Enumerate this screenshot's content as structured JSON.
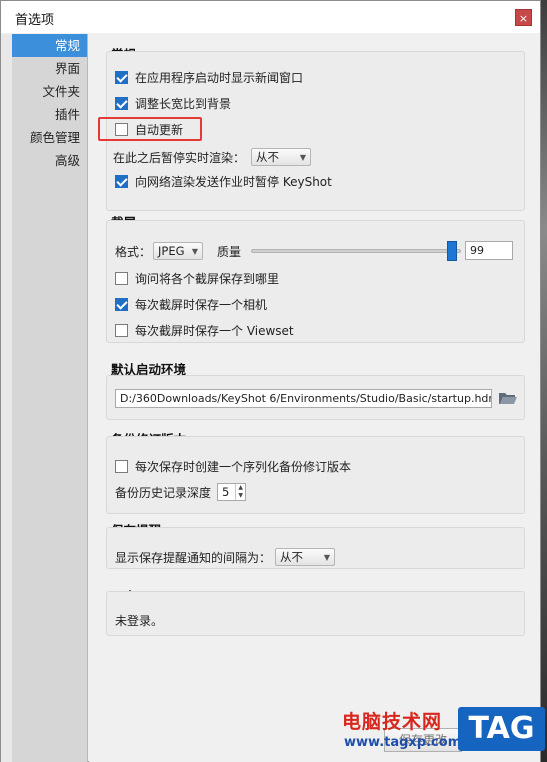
{
  "window": {
    "title": "首选项",
    "close_label": "×"
  },
  "sidebar": {
    "items": [
      {
        "label": "常规",
        "active": true
      },
      {
        "label": "界面"
      },
      {
        "label": "文件夹"
      },
      {
        "label": "插件"
      },
      {
        "label": "颜色管理"
      },
      {
        "label": "高级"
      }
    ]
  },
  "general": {
    "title": "常规",
    "show_news": {
      "label": "在应用程序启动时显示新闻窗口",
      "checked": true
    },
    "adjust_aspect": {
      "label": "调整长宽比到背景",
      "checked": true
    },
    "auto_update": {
      "label": "自动更新",
      "checked": false
    },
    "pause_render_label": "在此之后暂停实时渲染：",
    "pause_render_value": "从不",
    "pause_on_network": {
      "label": "向网络渲染发送作业时暂停 KeyShot",
      "checked": true
    }
  },
  "screenshot": {
    "title": "截屏",
    "format_label": "格式：",
    "format_value": "JPEG",
    "quality_label": "质量",
    "quality_value": "99",
    "ask_location": {
      "label": "询问将各个截屏保存到哪里",
      "checked": false
    },
    "save_camera": {
      "label": "每次截屏时保存一个相机",
      "checked": true
    },
    "save_viewset": {
      "label": "每次截屏时保存一个 Viewset",
      "checked": false
    }
  },
  "environment": {
    "title": "默认启动环境",
    "path": "D:/360Downloads/KeyShot 6/Environments/Studio/Basic/startup.hdr"
  },
  "backup": {
    "title": "备份修订版本",
    "serialize": {
      "label": "每次保存时创建一个序列化备份修订版本",
      "checked": false
    },
    "depth_label": "备份历史记录深度",
    "depth_value": "5"
  },
  "save_reminder": {
    "title": "保存提醒",
    "interval_label": "显示保存提醒通知的间隔为：",
    "interval_value": "从不"
  },
  "cloud": {
    "title": "云库",
    "status": "未登录。"
  },
  "footer": {
    "save_label": "保存更改"
  },
  "watermark": {
    "line1": "电脑技术网",
    "line2": "www.tagxp.com",
    "badge": "TAG"
  },
  "colors": {
    "accent": "#1f77d4",
    "highlight": "#e53935",
    "sidebar_active": "#3b8fdb"
  }
}
